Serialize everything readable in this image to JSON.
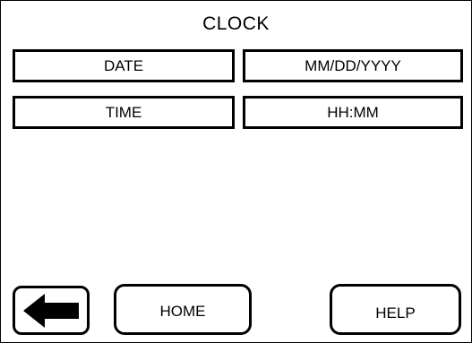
{
  "screen": {
    "title": "CLOCK"
  },
  "fields": {
    "date_label": "DATE",
    "date_value": "MM/DD/YYYY",
    "time_label": "TIME",
    "time_value": "HH:MM"
  },
  "nav": {
    "back_icon": "left-arrow-icon",
    "home_label": "HOME",
    "help_label": "HELP"
  }
}
